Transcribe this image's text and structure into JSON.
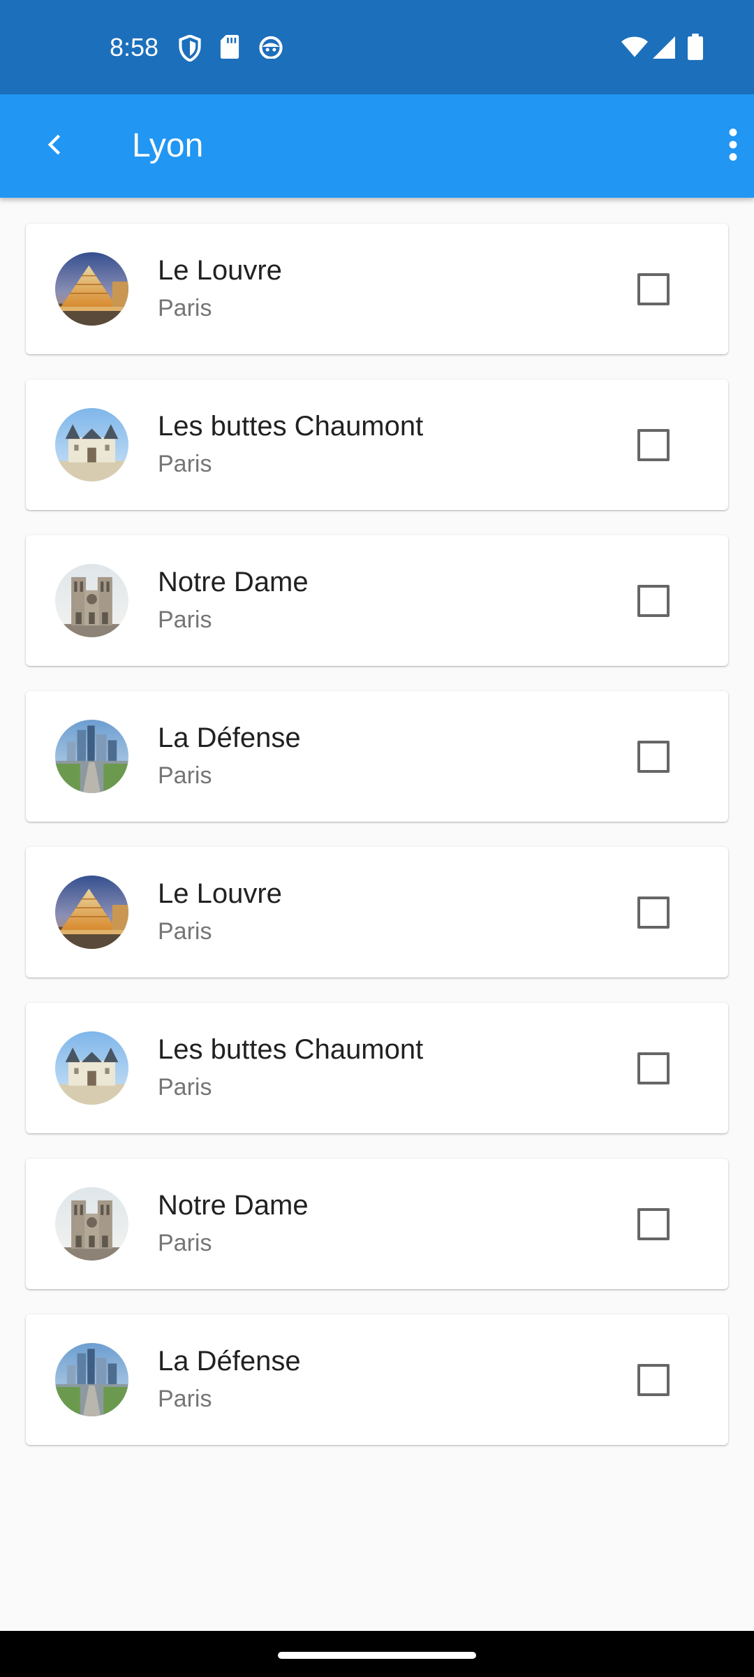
{
  "status_bar": {
    "time": "8:58",
    "left_icons": [
      "shield-icon",
      "sd-card-icon",
      "android-icon"
    ],
    "right_icons": [
      "wifi-icon",
      "signal-icon",
      "battery-icon"
    ]
  },
  "app_bar": {
    "title": "Lyon",
    "back_icon": "chevron-left-icon",
    "menu_icon": "more-vert-icon",
    "color": "#2196f3"
  },
  "places": [
    {
      "title": "Le Louvre",
      "subtitle": "Paris",
      "image": "louvre-pyramid",
      "checked": false
    },
    {
      "title": "Les buttes Chaumont",
      "subtitle": "Paris",
      "image": "chateau",
      "checked": false
    },
    {
      "title": "Notre Dame",
      "subtitle": "Paris",
      "image": "notre-dame",
      "checked": false
    },
    {
      "title": "La Défense",
      "subtitle": "Paris",
      "image": "la-defense",
      "checked": false
    },
    {
      "title": "Le Louvre",
      "subtitle": "Paris",
      "image": "louvre-pyramid",
      "checked": false
    },
    {
      "title": "Les buttes Chaumont",
      "subtitle": "Paris",
      "image": "chateau",
      "checked": false
    },
    {
      "title": "Notre Dame",
      "subtitle": "Paris",
      "image": "notre-dame",
      "checked": false
    },
    {
      "title": "La Défense",
      "subtitle": "Paris",
      "image": "la-defense",
      "checked": false
    }
  ]
}
